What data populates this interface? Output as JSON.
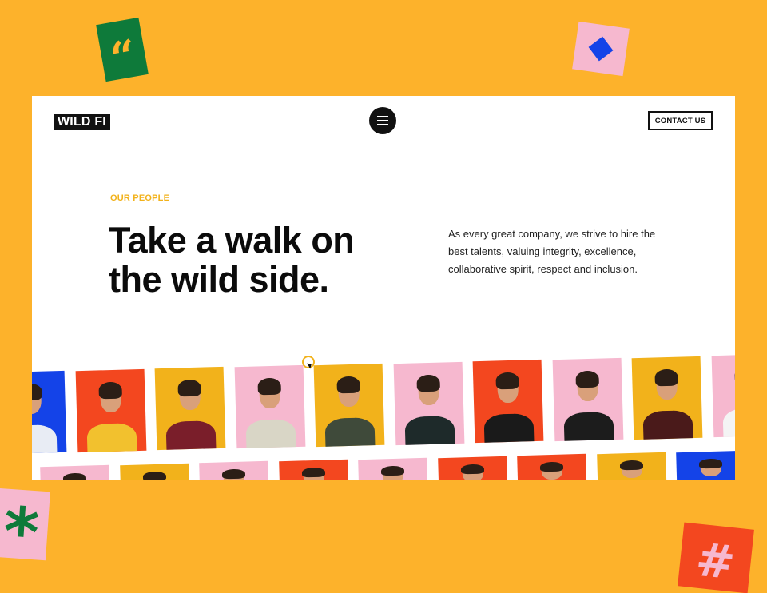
{
  "brand": {
    "logo_text": "WILD FI"
  },
  "nav": {
    "menu_icon": "hamburger-menu-icon",
    "contact_label": "CONTACT US"
  },
  "hero": {
    "eyebrow": "OUR PEOPLE",
    "headline_line1": "Take a walk on",
    "headline_line2": "the wild side.",
    "intro": "As every great company, we strive to hire the best talents, valuing integrity, excellence, collaborative spirit, respect and inclusion."
  },
  "colors": {
    "background": "#FDB22B",
    "accent_yellow": "#F2B21B",
    "green": "#0E7A3A",
    "pink": "#F6B8CF",
    "blue": "#1443E8",
    "red": "#F3471F"
  },
  "stickers": [
    {
      "name": "quote-sticker",
      "glyph": "“"
    },
    {
      "name": "diamond-sticker",
      "glyph": ""
    },
    {
      "name": "asterisk-sticker",
      "glyph": "*"
    },
    {
      "name": "hash-sticker",
      "glyph": "#"
    }
  ],
  "people_row1": [
    {
      "bg": "#1443E8",
      "shirt": "#E8ECF4"
    },
    {
      "bg": "#F3471F",
      "shirt": "#F2C12E"
    },
    {
      "bg": "#F2B21B",
      "shirt": "#7A1E2A"
    },
    {
      "bg": "#F6B8CF",
      "shirt": "#D9D6C6"
    },
    {
      "bg": "#F2B21B",
      "shirt": "#3F4A3A"
    },
    {
      "bg": "#F6B8CF",
      "shirt": "#1E2A2A"
    },
    {
      "bg": "#F3471F",
      "shirt": "#1A1A1A"
    },
    {
      "bg": "#F6B8CF",
      "shirt": "#1C1C1C"
    },
    {
      "bg": "#F2B21B",
      "shirt": "#4A1A1A"
    },
    {
      "bg": "#F6B8CF",
      "shirt": "#F4F4F4"
    }
  ],
  "people_row2": [
    {
      "bg": "#F6B8CF",
      "shirt": "#2A2A2A"
    },
    {
      "bg": "#F2B21B",
      "shirt": "#E8D9B0"
    },
    {
      "bg": "#F6B8CF",
      "shirt": "#333"
    },
    {
      "bg": "#F3471F",
      "shirt": "#222"
    },
    {
      "bg": "#F6B8CF",
      "shirt": "#444"
    },
    {
      "bg": "#F3471F",
      "shirt": "#333"
    },
    {
      "bg": "#F3471F",
      "shirt": "#222"
    },
    {
      "bg": "#F2B21B",
      "shirt": "#333"
    },
    {
      "bg": "#1443E8",
      "shirt": "#DDD"
    }
  ]
}
